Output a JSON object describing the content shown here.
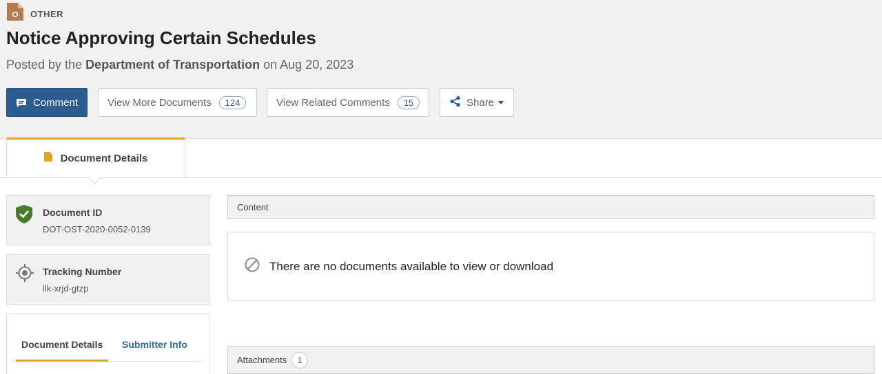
{
  "document": {
    "type_label": "OTHER",
    "title": "Notice Approving Certain Schedules",
    "posted_prefix": "Posted by the",
    "agency": "Department of Transportation",
    "posted_on": "on Aug 20, 2023"
  },
  "actions": {
    "comment_label": "Comment",
    "more_docs_label": "View More Documents",
    "more_docs_count": "124",
    "related_comments_label": "View Related Comments",
    "related_comments_count": "15",
    "share_label": "Share"
  },
  "tabs": {
    "document_details": "Document Details"
  },
  "sidebar": {
    "document_id_label": "Document ID",
    "document_id_value": "DOT-OST-2020-0052-0139",
    "tracking_label": "Tracking Number",
    "tracking_value": "llk-xrjd-gtzp",
    "subtabs": [
      "Document Details",
      "Submitter Info"
    ]
  },
  "content": {
    "section_label": "Content",
    "empty_message": "There are no documents available to view or download",
    "attachments_label": "Attachments",
    "attachments_count": "1"
  },
  "colors": {
    "primary": "#2d5c8f",
    "accent": "#e2a32a",
    "verified": "#4a7a2c"
  },
  "icons": {
    "doc_type": "document-type-icon",
    "comment": "comment-icon",
    "share": "share-icon",
    "tab": "document-icon",
    "document_id": "shield-check-icon",
    "tracking": "crosshair-icon",
    "empty": "no-entry-icon"
  }
}
